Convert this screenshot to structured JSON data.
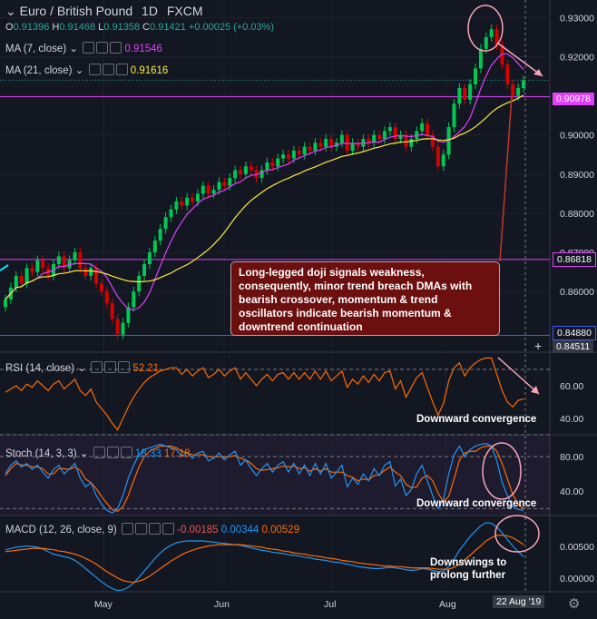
{
  "header": {
    "symbol": "Euro / British Pound",
    "interval": "1D",
    "source": "FXCM",
    "ohlc": {
      "O": "0.91396",
      "H": "0.91468",
      "L": "0.91358",
      "C": "0.91421",
      "change": "+0.00025 (+0.03%)"
    }
  },
  "indicators": {
    "ma7": {
      "label": "MA (7, close)",
      "value": "0.91546",
      "color": "#e040fb"
    },
    "ma21": {
      "label": "MA (21, close)",
      "value": "0.91616",
      "color": "#ffeb3b"
    },
    "rsi": {
      "label": "RSI (14, close)",
      "value": "52.21",
      "color": "#ff6a00"
    },
    "stoch": {
      "label": "Stoch (14, 3, 3)",
      "k": "18.33",
      "d": "17.18",
      "k_color": "#2196f3",
      "d_color": "#ff6a00"
    },
    "macd": {
      "label": "MACD (12, 26, close, 9)",
      "hist": "-0.00185",
      "macd": "0.00344",
      "signal": "0.00529"
    }
  },
  "annotation_box": "Long-legged doji signals weakness, consequently, minor trend breach DMAs with bearish crossover, momentum & trend oscillators indicate bearish momentum & downtrend continuation",
  "annotations": {
    "rsi": "Downward convergence",
    "stoch": "Downward convergence",
    "macd_line1": "Downswings to",
    "macd_line2": "prolong further"
  },
  "price_tags": {
    "upper": "0.90978",
    "middle": "0.86818",
    "lower": "0.84880",
    "cursor": "0.84511"
  },
  "x_axis": {
    "months": [
      "May",
      "Jun",
      "Jul",
      "Aug"
    ],
    "date_tag": "22 Aug '19"
  },
  "chart_data": [
    {
      "type": "candlestick",
      "title": "Euro / British Pound 1D FXCM",
      "ylim": [
        0.8445,
        0.9345
      ],
      "y_ticks": [
        0.93,
        0.92,
        0.91,
        0.9,
        0.89,
        0.88,
        0.87,
        0.86
      ],
      "close": [
        0.858,
        0.861,
        0.864,
        0.862,
        0.866,
        0.865,
        0.868,
        0.866,
        0.864,
        0.867,
        0.869,
        0.866,
        0.868,
        0.87,
        0.866,
        0.864,
        0.866,
        0.862,
        0.86,
        0.857,
        0.853,
        0.849,
        0.852,
        0.856,
        0.86,
        0.864,
        0.867,
        0.87,
        0.873,
        0.876,
        0.879,
        0.881,
        0.883,
        0.882,
        0.884,
        0.883,
        0.885,
        0.887,
        0.885,
        0.886,
        0.888,
        0.887,
        0.889,
        0.891,
        0.89,
        0.892,
        0.891,
        0.889,
        0.891,
        0.893,
        0.892,
        0.894,
        0.895,
        0.894,
        0.896,
        0.895,
        0.897,
        0.896,
        0.898,
        0.897,
        0.899,
        0.897,
        0.898,
        0.9,
        0.896,
        0.898,
        0.897,
        0.899,
        0.898,
        0.9,
        0.899,
        0.901,
        0.902,
        0.899,
        0.9,
        0.897,
        0.899,
        0.901,
        0.903,
        0.9,
        0.897,
        0.892,
        0.895,
        0.902,
        0.908,
        0.912,
        0.909,
        0.913,
        0.917,
        0.922,
        0.925,
        0.927,
        0.923,
        0.918,
        0.913,
        0.91,
        0.912,
        0.914
      ],
      "series": [
        {
          "name": "MA (7, close)",
          "color": "#e040fb"
        },
        {
          "name": "MA (21, close)",
          "color": "#ffeb3b"
        }
      ]
    },
    {
      "type": "line",
      "title": "RSI (14, close)",
      "ylim": [
        30,
        80
      ],
      "y_ticks": [
        60,
        40
      ],
      "values": [
        56,
        58,
        60,
        57,
        61,
        59,
        63,
        60,
        57,
        61,
        63,
        58,
        61,
        64,
        57,
        54,
        58,
        50,
        46,
        42,
        37,
        33,
        40,
        47,
        53,
        58,
        62,
        65,
        67,
        69,
        70,
        71,
        71,
        67,
        70,
        66,
        69,
        71,
        65,
        67,
        70,
        66,
        69,
        71,
        64,
        68,
        64,
        60,
        64,
        67,
        63,
        67,
        68,
        64,
        68,
        64,
        68,
        64,
        69,
        64,
        69,
        63,
        66,
        69,
        59,
        64,
        61,
        66,
        62,
        67,
        63,
        68,
        69,
        58,
        63,
        53,
        59,
        65,
        68,
        59,
        50,
        42,
        49,
        63,
        71,
        74,
        66,
        71,
        74,
        76,
        77,
        77,
        67,
        57,
        50,
        47,
        51,
        52
      ]
    },
    {
      "type": "line",
      "title": "Stoch (14, 3, 3)",
      "ylim": [
        12,
        104
      ],
      "y_ticks": [
        80,
        40
      ],
      "series": [
        {
          "name": "%K",
          "values": [
            60,
            70,
            75,
            68,
            72,
            65,
            70,
            62,
            55,
            65,
            70,
            60,
            66,
            72,
            55,
            45,
            50,
            35,
            25,
            18,
            15,
            20,
            35,
            55,
            70,
            82,
            88,
            90,
            92,
            94,
            92,
            90,
            88,
            80,
            85,
            78,
            84,
            86,
            75,
            78,
            84,
            76,
            82,
            86,
            70,
            76,
            66,
            58,
            66,
            72,
            62,
            70,
            74,
            62,
            72,
            60,
            70,
            58,
            72,
            60,
            72,
            55,
            62,
            70,
            45,
            55,
            48,
            60,
            52,
            66,
            58,
            70,
            74,
            46,
            54,
            35,
            42,
            60,
            70,
            52,
            35,
            20,
            30,
            60,
            82,
            92,
            80,
            88,
            92,
            94,
            95,
            92,
            75,
            50,
            35,
            22,
            19,
            18
          ]
        },
        {
          "name": "%D",
          "values": [
            58,
            66,
            72,
            70,
            70,
            68,
            68,
            66,
            60,
            60,
            66,
            66,
            65,
            68,
            64,
            54,
            50,
            43,
            34,
            26,
            19,
            17,
            22,
            35,
            52,
            68,
            80,
            86,
            89,
            92,
            92,
            92,
            90,
            86,
            84,
            82,
            82,
            82,
            80,
            79,
            80,
            79,
            80,
            81,
            78,
            76,
            72,
            66,
            64,
            65,
            66,
            67,
            69,
            68,
            69,
            66,
            67,
            63,
            66,
            63,
            66,
            62,
            62,
            62,
            58,
            56,
            52,
            54,
            53,
            58,
            59,
            64,
            68,
            62,
            58,
            48,
            44,
            45,
            55,
            58,
            52,
            38,
            28,
            34,
            54,
            76,
            84,
            86,
            86,
            90,
            92,
            92,
            86,
            72,
            54,
            36,
            25,
            20
          ]
        }
      ]
    },
    {
      "type": "line",
      "title": "MACD (12, 26, close, 9)",
      "ylim": [
        -0.0022,
        0.0098
      ],
      "y_ticks": [
        0.005,
        0.0
      ],
      "series": [
        {
          "name": "MACD",
          "values": [
            0.0045,
            0.0047,
            0.0049,
            0.005,
            0.0051,
            0.005,
            0.0049,
            0.0046,
            0.0042,
            0.0038,
            0.0036,
            0.0034,
            0.0032,
            0.0028,
            0.0022,
            0.0015,
            0.0008,
            0.0001,
            -0.0006,
            -0.0012,
            -0.0017,
            -0.002,
            -0.0019,
            -0.0015,
            -0.0008,
            0.0001,
            0.0011,
            0.0021,
            0.0031,
            0.004,
            0.0047,
            0.0052,
            0.0056,
            0.0058,
            0.0059,
            0.0059,
            0.0059,
            0.0059,
            0.0058,
            0.0057,
            0.0056,
            0.0055,
            0.0054,
            0.0053,
            0.0052,
            0.005,
            0.0048,
            0.0046,
            0.0044,
            0.0043,
            0.0041,
            0.004,
            0.0039,
            0.0037,
            0.0036,
            0.0035,
            0.0033,
            0.0032,
            0.003,
            0.0029,
            0.0028,
            0.0026,
            0.0025,
            0.0024,
            0.0022,
            0.002,
            0.0018,
            0.0017,
            0.0016,
            0.0015,
            0.0015,
            0.0016,
            0.0017,
            0.0016,
            0.0015,
            0.0013,
            0.0012,
            0.0013,
            0.0015,
            0.0014,
            0.0012,
            0.001,
            0.0011,
            0.0018,
            0.003,
            0.0044,
            0.0055,
            0.0066,
            0.0075,
            0.0083,
            0.0088,
            0.0087,
            0.0081,
            0.0072,
            0.0061,
            0.0051,
            0.0042,
            0.0034
          ]
        },
        {
          "name": "Signal",
          "values": [
            0.0042,
            0.0043,
            0.0044,
            0.0045,
            0.0046,
            0.0047,
            0.0047,
            0.0047,
            0.0046,
            0.0045,
            0.0043,
            0.0042,
            0.004,
            0.0038,
            0.0035,
            0.0031,
            0.0027,
            0.0022,
            0.0016,
            0.001,
            0.0005,
            0.0,
            -0.0004,
            -0.0006,
            -0.0007,
            -0.0005,
            -0.0002,
            0.0003,
            0.0009,
            0.0015,
            0.0021,
            0.0027,
            0.0032,
            0.0037,
            0.0041,
            0.0044,
            0.0047,
            0.0049,
            0.0051,
            0.0052,
            0.0053,
            0.0053,
            0.0053,
            0.0053,
            0.0053,
            0.0052,
            0.0051,
            0.005,
            0.0049,
            0.0047,
            0.0046,
            0.0045,
            0.0043,
            0.0042,
            0.004,
            0.0039,
            0.0038,
            0.0036,
            0.0035,
            0.0034,
            0.0032,
            0.0031,
            0.003,
            0.0028,
            0.0027,
            0.0026,
            0.0024,
            0.0023,
            0.0022,
            0.0021,
            0.002,
            0.0019,
            0.0019,
            0.0018,
            0.0018,
            0.0017,
            0.0016,
            0.0016,
            0.0016,
            0.0016,
            0.0015,
            0.0014,
            0.0014,
            0.0014,
            0.0017,
            0.0022,
            0.0029,
            0.0036,
            0.0044,
            0.0051,
            0.0059,
            0.0064,
            0.0068,
            0.0068,
            0.0067,
            0.0064,
            0.0059,
            0.0053
          ]
        }
      ]
    }
  ]
}
